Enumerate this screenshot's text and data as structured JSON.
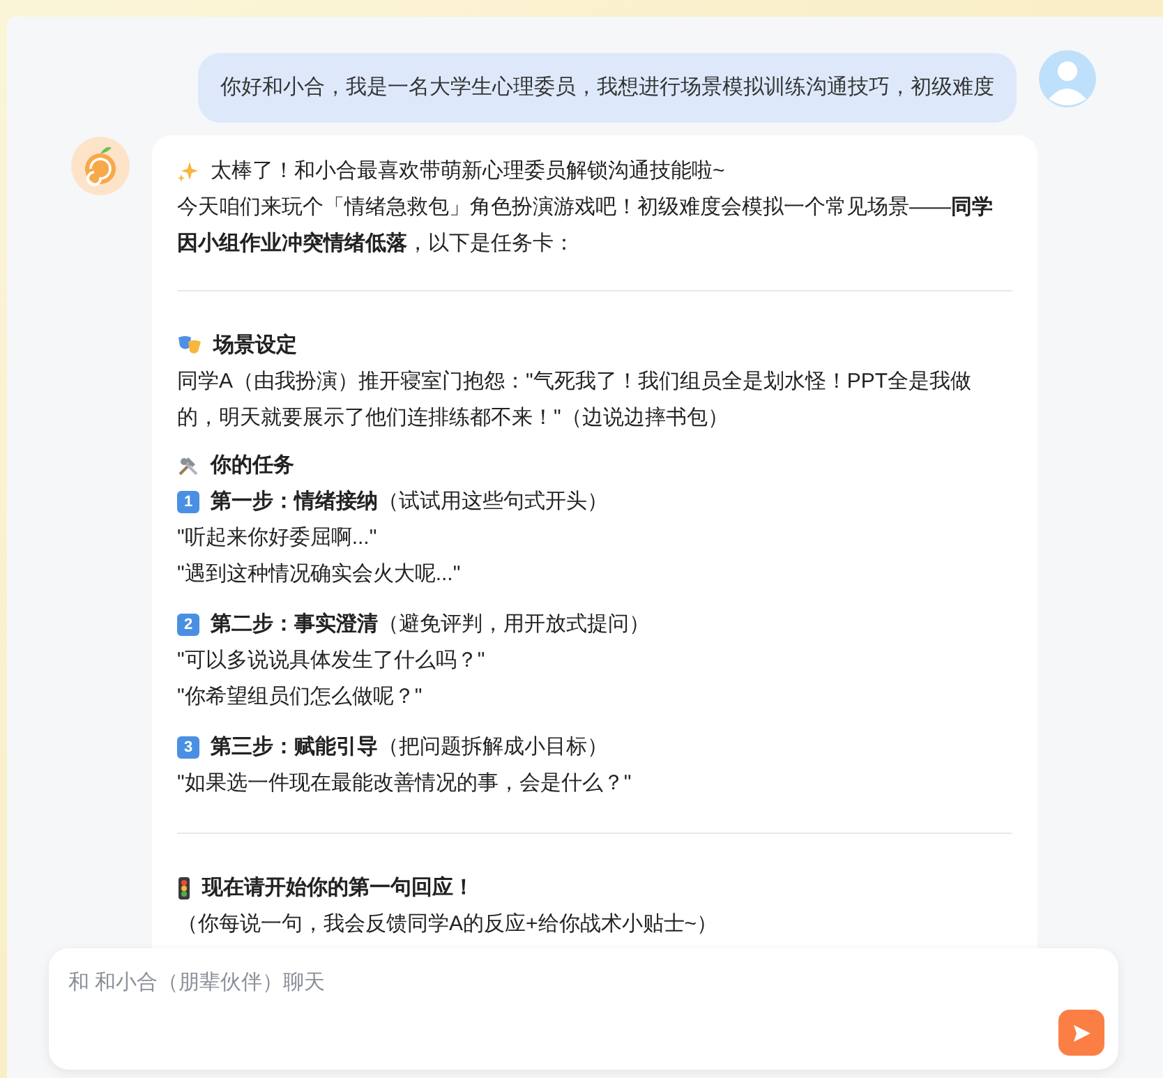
{
  "user_message": {
    "text": "你好和小合，我是一名大学生心理委员，我想进行场景模拟训练沟通技巧，初级难度"
  },
  "bot_message": {
    "greeting": "太棒了！和小合最喜欢带萌新心理委员解锁沟通技能啦~",
    "intro": "今天咱们来玩个「情绪急救包」角色扮演游戏吧！初级难度会模拟一个常见场景——**同学因小组作业冲突情绪低落**，以下是任务卡：",
    "scene": {
      "title": "场景设定",
      "text": "同学A（由我扮演）推开寝室门抱怨：\"气死我了！我们组员全是划水怪！PPT全是我做的，明天就要展示了他们连排练都不来！\"（边说边摔书包）"
    },
    "task": {
      "title": "你的任务",
      "steps": [
        {
          "number": "1",
          "title": "第一步：情绪接纳",
          "hint": "（试试用这些句式开头）",
          "phrases": [
            "\"听起来你好委屈啊...\"",
            "\"遇到这种情况确实会火大呢...\""
          ]
        },
        {
          "number": "2",
          "title": "第二步：事实澄清",
          "hint": "（避免评判，用开放式提问）",
          "phrases": [
            "\"可以多说说具体发生了什么吗？\"",
            "\"你希望组员们怎么做呢？\""
          ]
        },
        {
          "number": "3",
          "title": "第三步：赋能引导",
          "hint": "（把问题拆解成小目标）",
          "phrases": [
            "\"如果选一件现在最能改善情况的事，会是什么？\""
          ]
        }
      ]
    },
    "start": {
      "title": "现在请开始你的第一句回应！",
      "text": "（你每说一句，我会反馈同学A的反应+给你战术小贴士~）"
    }
  },
  "composer": {
    "placeholder": "和 和小合（朋辈伙伴）聊天"
  }
}
